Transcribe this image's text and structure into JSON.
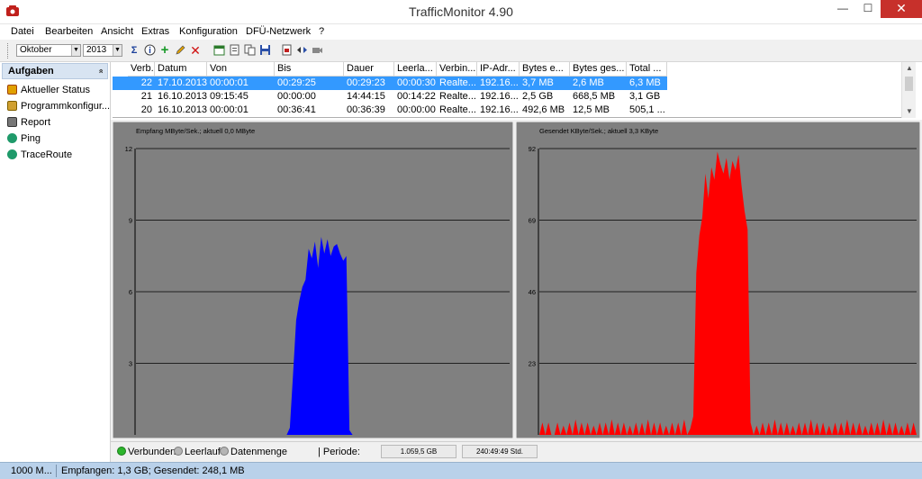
{
  "window": {
    "title": "TrafficMonitor 4.90",
    "minimize": "—",
    "maximize": "☐",
    "close": "✕"
  },
  "menu": [
    "Datei",
    "Bearbeiten",
    "Ansicht",
    "Extras",
    "Konfiguration",
    "DFÜ-Netzwerk",
    "?"
  ],
  "toolbar": {
    "month": "Oktober",
    "year": "2013"
  },
  "sidebar": {
    "header": "Aufgaben",
    "collapse_glyph": "»",
    "items": [
      "Aktueller Status",
      "Programmkonfigur...",
      "Report",
      "Ping",
      "TraceRoute"
    ]
  },
  "table": {
    "headers": [
      "Verb.",
      "Datum",
      "Von",
      "Bis",
      "Dauer",
      "Leerla...",
      "Verbin...",
      "IP-Adr...",
      "Bytes e...",
      "Bytes ges...",
      "Total ..."
    ],
    "rows": [
      [
        "22",
        "17.10.2013",
        "00:00:01",
        "00:29:25",
        "00:29:23",
        "00:00:30",
        "Realte...",
        "192.16...",
        "3,7 MB",
        "2,6 MB",
        "6,3 MB"
      ],
      [
        "21",
        "16.10.2013",
        "09:15:45",
        "00:00:00",
        "14:44:15",
        "00:14:22",
        "Realte...",
        "192.16...",
        "2,5 GB",
        "668,5 MB",
        "3,1 GB"
      ],
      [
        "20",
        "16.10.2013",
        "00:00:01",
        "00:36:41",
        "00:36:39",
        "00:00:00",
        "Realte...",
        "192.16...",
        "492,6 MB",
        "12,5 MB",
        "505,1 ..."
      ]
    ]
  },
  "charts": {
    "receive": {
      "title": "Empfang MByte/Sek.; aktuell 0,0 MByte",
      "ticks": [
        "12",
        "9",
        "6",
        "3"
      ],
      "color": "#0000ff"
    },
    "send": {
      "title": "Gesendet KByte/Sek.; aktuell 3,3 KByte",
      "ticks": [
        "92",
        "69",
        "46",
        "23"
      ],
      "color": "#ff0000"
    }
  },
  "chart_data": [
    {
      "type": "area",
      "title": "Empfang MByte/Sek.; aktuell 0,0 MByte",
      "ylim": [
        0,
        12
      ],
      "y_ticks": [
        3,
        6,
        9,
        12
      ],
      "grid": true,
      "series": [
        {
          "values": [
            0,
            0,
            0,
            0,
            0,
            0,
            0,
            0,
            0,
            0,
            0,
            0,
            0,
            0,
            0,
            0,
            0,
            0,
            0,
            0,
            0,
            0,
            0,
            0,
            0,
            0,
            0,
            0,
            0,
            0,
            0,
            0,
            0,
            0,
            0,
            0,
            0,
            0,
            0,
            0,
            0,
            0,
            0,
            0,
            0,
            0,
            0,
            0,
            0,
            0.3,
            2.5,
            4.8,
            5.6,
            6.2,
            6.5,
            7.8,
            7.4,
            8.1,
            7.0,
            8.3,
            7.6,
            8.2,
            7.5,
            7.9,
            8.0,
            7.6,
            7.3,
            7.5,
            0.2,
            0,
            0,
            0,
            0,
            0,
            0,
            0,
            0,
            0,
            0,
            0,
            0,
            0,
            0,
            0,
            0,
            0,
            0,
            0,
            0,
            0,
            0,
            0,
            0,
            0,
            0,
            0,
            0,
            0,
            0,
            0,
            0,
            0,
            0,
            0,
            0,
            0,
            0,
            0,
            0,
            0,
            0,
            0,
            0,
            0,
            0,
            0,
            0,
            0,
            0,
            0
          ]
        }
      ]
    },
    {
      "type": "area",
      "title": "Gesendet KByte/Sek.; aktuell 3,3 KByte",
      "ylim": [
        0,
        92
      ],
      "y_ticks": [
        23,
        46,
        69,
        92
      ],
      "grid": true,
      "series": [
        {
          "values": [
            0,
            4,
            0,
            4,
            0,
            0,
            4,
            0,
            3,
            0,
            4,
            0,
            5,
            0,
            4,
            0,
            4,
            0,
            3,
            0,
            4,
            0,
            4,
            0,
            5,
            0,
            4,
            0,
            4,
            0,
            3,
            0,
            4,
            0,
            4,
            0,
            5,
            0,
            4,
            0,
            4,
            0,
            3,
            0,
            4,
            0,
            4,
            0,
            5,
            0,
            2,
            6,
            52,
            64,
            70,
            84,
            76,
            86,
            82,
            91,
            87,
            84,
            89,
            82,
            88,
            85,
            90,
            80,
            72,
            66,
            4,
            0,
            3,
            0,
            4,
            0,
            4,
            0,
            5,
            0,
            4,
            0,
            4,
            0,
            3,
            0,
            4,
            0,
            4,
            0,
            5,
            0,
            4,
            0,
            4,
            0,
            3,
            0,
            4,
            0,
            4,
            0,
            5,
            0,
            4,
            0,
            4,
            0,
            3,
            0,
            4,
            0,
            4,
            0,
            5,
            0,
            4,
            0,
            4,
            0,
            3,
            0,
            4,
            0,
            4,
            0
          ]
        }
      ]
    }
  ],
  "status": {
    "connected": "Verbunden",
    "idle": "Leerlauf",
    "datavolume": "Datenmenge",
    "period_label": "| Periode:",
    "period_volume": "1.059,5 GB",
    "period_time": "240:49:49 Std.",
    "speed": "1000 M...",
    "received_sent": "Empfangen: 1,3 GB; Gesendet: 248,1 MB"
  }
}
